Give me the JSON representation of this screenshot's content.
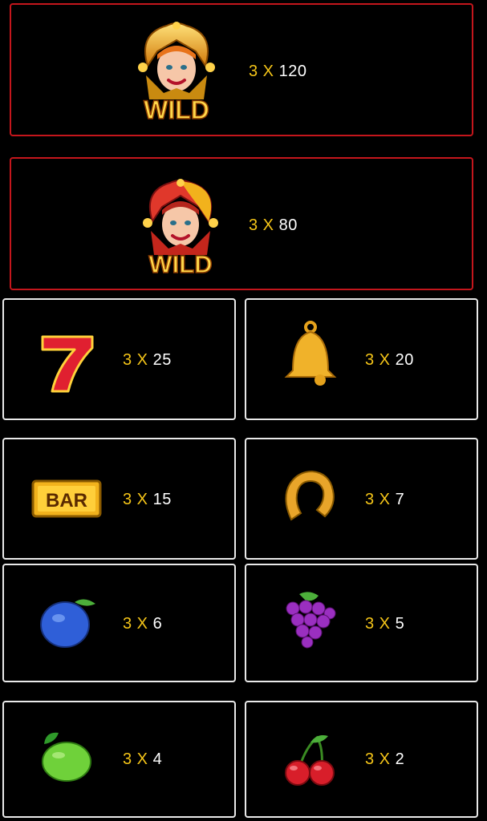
{
  "colors": {
    "border_red": "#c4161c",
    "border_white": "#e9e9e9",
    "multiplier_gold": "#f5c518",
    "value_white": "#ffffff"
  },
  "paytable": [
    {
      "symbol": "wild-gold-jester-icon",
      "logo_text": "WILD",
      "prefix": "3 X",
      "value": "120"
    },
    {
      "symbol": "wild-red-jester-icon",
      "logo_text": "WILD",
      "prefix": "3 X",
      "value": "80"
    },
    {
      "symbol": "seven-icon",
      "prefix": "3 X",
      "value": "25"
    },
    {
      "symbol": "bell-icon",
      "prefix": "3 X",
      "value": "20"
    },
    {
      "symbol": "bar-icon",
      "logo_text": "BAR",
      "prefix": "3 X",
      "value": "15"
    },
    {
      "symbol": "horseshoe-icon",
      "prefix": "3 X",
      "value": "7"
    },
    {
      "symbol": "plum-icon",
      "prefix": "3 X",
      "value": "6"
    },
    {
      "symbol": "grapes-icon",
      "prefix": "3 X",
      "value": "5"
    },
    {
      "symbol": "lime-icon",
      "prefix": "3 X",
      "value": "4"
    },
    {
      "symbol": "cherry-icon",
      "prefix": "3 X",
      "value": "2"
    }
  ]
}
